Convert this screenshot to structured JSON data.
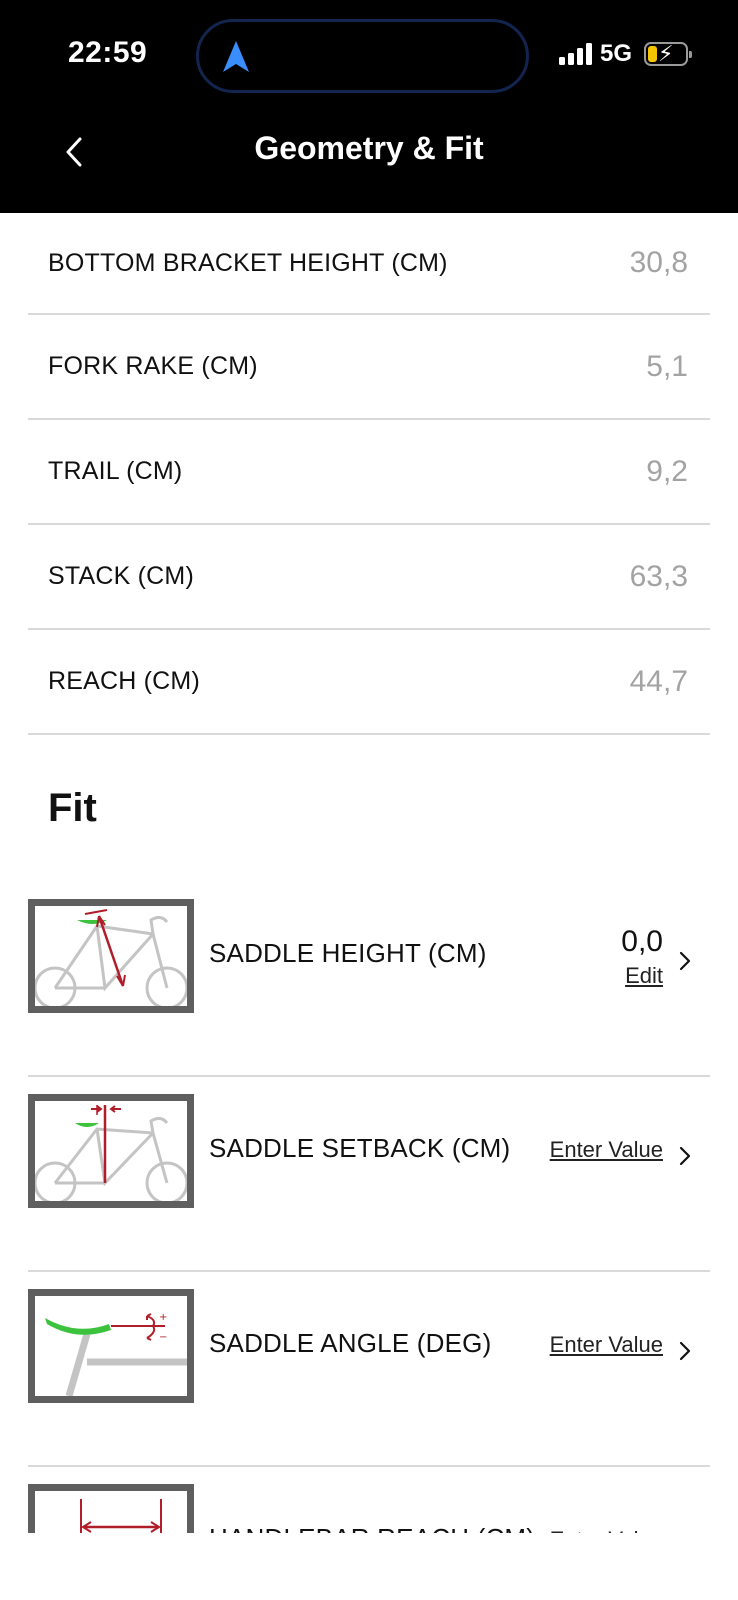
{
  "status_bar": {
    "time": "22:59",
    "network": "5G"
  },
  "header": {
    "title": "Geometry & Fit"
  },
  "geometry": [
    {
      "label": "BOTTOM BRACKET HEIGHT (CM)",
      "value": "30,8"
    },
    {
      "label": "FORK RAKE (CM)",
      "value": "5,1"
    },
    {
      "label": "TRAIL (CM)",
      "value": "9,2"
    },
    {
      "label": "STACK (CM)",
      "value": "63,3"
    },
    {
      "label": "REACH (CM)",
      "value": "44,7"
    }
  ],
  "fit": {
    "title": "Fit",
    "items": [
      {
        "label": "SADDLE HEIGHT (CM)",
        "value": "0,0",
        "action": "Edit"
      },
      {
        "label": "SADDLE SETBACK (CM)",
        "action": "Enter Value"
      },
      {
        "label": "SADDLE ANGLE (DEG)",
        "action": "Enter Value"
      },
      {
        "label": "HANDLEBAR REACH (CM)",
        "action": "Enter Value"
      }
    ]
  },
  "colors": {
    "accent_red": "#b01e2a",
    "saddle_green": "#3cc23c",
    "bike_gray": "#c4c4c4"
  }
}
